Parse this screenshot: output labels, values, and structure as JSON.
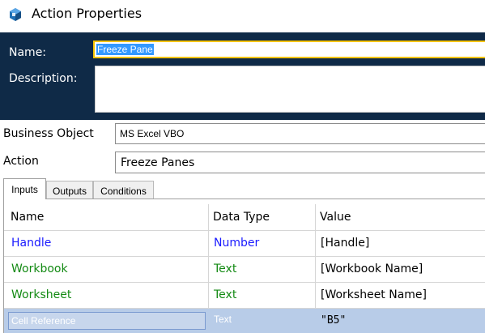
{
  "window": {
    "title": "Action Properties",
    "icon": "blue-cube-icon"
  },
  "header": {
    "name_label": "Name:",
    "name_value": "Freeze Pane",
    "description_label": "Description:",
    "description_value": ""
  },
  "business_object": {
    "label": "Business Object",
    "value": "MS Excel VBO"
  },
  "action": {
    "label": "Action",
    "value": "Freeze Panes"
  },
  "tabs": [
    {
      "label": "Inputs",
      "active": true
    },
    {
      "label": "Outputs",
      "active": false
    },
    {
      "label": "Conditions",
      "active": false
    }
  ],
  "grid": {
    "columns": [
      "Name",
      "Data Type",
      "Value"
    ],
    "rows": [
      {
        "name": "Handle",
        "type": "Number",
        "value": "[Handle]",
        "color": "#1a1aff"
      },
      {
        "name": "Workbook",
        "type": "Text",
        "value": "[Workbook Name]",
        "color": "#138a13"
      },
      {
        "name": "Worksheet",
        "type": "Text",
        "value": "[Worksheet Name]",
        "color": "#138a13"
      },
      {
        "name": "Cell Reference",
        "type": "Text",
        "value": "\"B5\"",
        "selected": true
      }
    ]
  },
  "colors": {
    "header_bg": "#0f2a47",
    "name_border": "#f5c400",
    "selection": "#b8cce8"
  }
}
